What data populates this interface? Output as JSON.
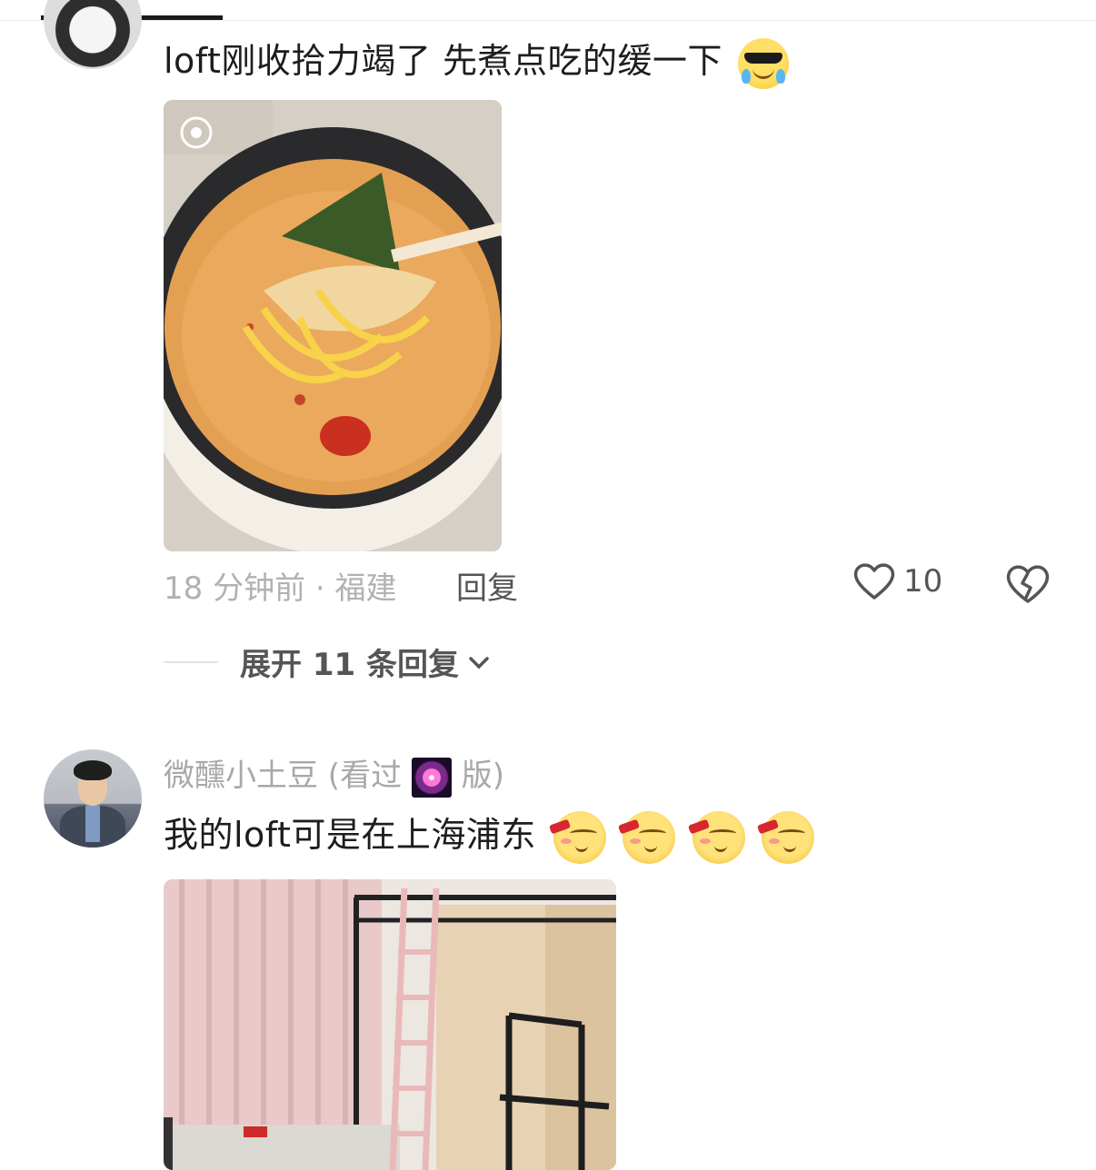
{
  "comments": [
    {
      "text": "loft刚收拾力竭了 先煮点吃的缓一下",
      "emoji": "cool-crying-face",
      "photo": "noodle-pot-photo",
      "meta": "18 分钟前 · 福建",
      "reply_label": "回复",
      "likes": "10",
      "expand_label": "展开 11 条回复"
    },
    {
      "username": "微醺小土豆 (看过",
      "username_suffix": "版)",
      "text": "我的loft可是在上海浦东",
      "emoji": "smug-drinking-face",
      "emoji_count": 4,
      "photo": "loft-room-photo"
    }
  ],
  "colors": {
    "accent_text": "#1d1d1d",
    "meta_text": "#b1b1b1",
    "icon": "#555555"
  }
}
